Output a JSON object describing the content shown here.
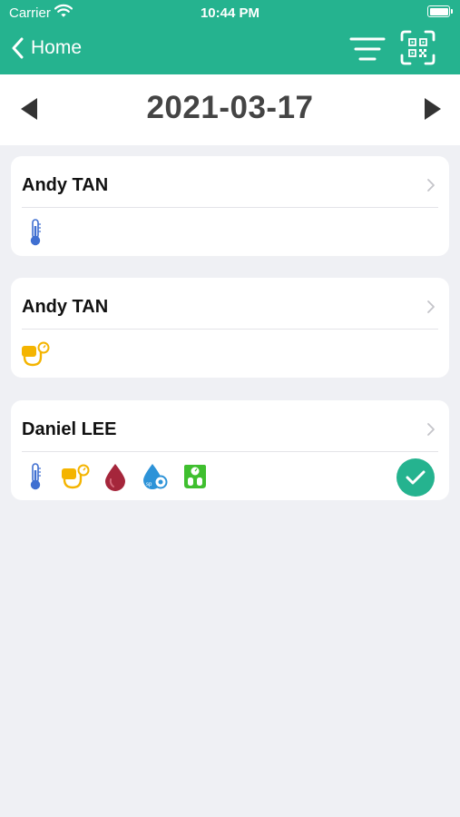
{
  "status_bar": {
    "carrier": "Carrier",
    "time": "10:44 PM"
  },
  "nav": {
    "back_label": "Home"
  },
  "date_nav": {
    "date": "2021-03-17"
  },
  "records": [
    {
      "name": "Andy TAN",
      "icons": [
        "thermometer-icon"
      ],
      "completed": false
    },
    {
      "name": "Andy TAN",
      "icons": [
        "blood-pressure-icon"
      ],
      "completed": false
    },
    {
      "name": "Daniel LEE",
      "icons": [
        "thermometer-icon",
        "blood-pressure-icon",
        "blood-glucose-icon",
        "spo2-icon",
        "weight-scale-icon"
      ],
      "completed": true
    }
  ],
  "colors": {
    "accent": "#25b38f",
    "background": "#eff0f4",
    "thermometer": "#3f6fd1",
    "blood_pressure": "#f4b400",
    "blood_glucose": "#a5263b",
    "spo2": "#2d93d8",
    "weight": "#3fbf2f"
  }
}
